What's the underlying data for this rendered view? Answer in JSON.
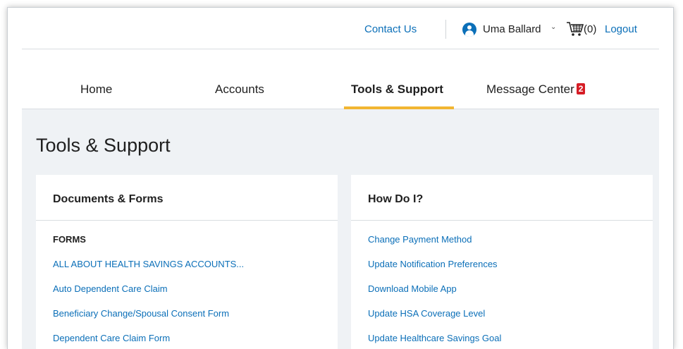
{
  "utility": {
    "contact_us": "Contact Us",
    "user_name": "Uma Ballard",
    "cart_count": "(0)",
    "logout": "Logout"
  },
  "nav": {
    "tabs": [
      {
        "label": "Home"
      },
      {
        "label": "Accounts"
      },
      {
        "label": "Tools & Support"
      },
      {
        "label": "Message Center"
      }
    ],
    "message_badge": "2"
  },
  "page": {
    "title": "Tools & Support"
  },
  "documents": {
    "title": "Documents & Forms",
    "section": "FORMS",
    "links": [
      "ALL ABOUT HEALTH SAVINGS ACCOUNTS...",
      "Auto Dependent Care Claim",
      "Beneficiary Change/Spousal Consent Form",
      "Dependent Care Claim Form"
    ]
  },
  "howto": {
    "title": "How Do I?",
    "links": [
      "Change Payment Method",
      "Update Notification Preferences",
      "Download Mobile App",
      "Update HSA Coverage Level",
      "Update Healthcare Savings Goal"
    ]
  },
  "colors": {
    "link": "#0b6fb8",
    "accent_underline": "#f2b632",
    "badge": "#d61d26",
    "content_bg": "#eff2f5"
  }
}
